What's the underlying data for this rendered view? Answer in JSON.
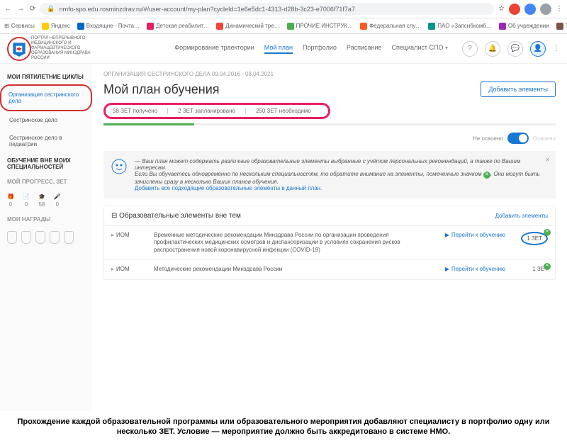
{
  "browser": {
    "url": "nmfo-spo.edu.rosminzdrav.ru/#/user-account/my-plan?cycleId=1e6e5dc1-4313-d28b-3c23-e7006f71f7a7",
    "bookmarks": [
      "Сервисы",
      "Яндекс",
      "Входящие - Почта…",
      "Детская реабилит…",
      "Динамический тре…",
      "ПРОЧИЕ ИНСТРУК…",
      "Федеральная слу…",
      "ПАО «Запсибкомб…",
      "Об учреждении",
      "Тюменская госуда…"
    ]
  },
  "header": {
    "logo_text": "ПОРТАЛ НЕПРЕРЫВНОГО МЕДИЦИНСКОГО И ФАРМАЦЕВТИЧЕСКОГО ОБРАЗОВАНИЯ МИНЗДРАВА РОССИИ",
    "tabs": [
      "Формирование траектории",
      "Мой план",
      "Портфолио",
      "Расписание",
      "Специалист СПО"
    ]
  },
  "sidebar": {
    "title1": "МОИ ПЯТИЛЕТНИЕ ЦИКЛЫ",
    "items1": [
      "Организация сестринского дела",
      "Сестринское дело",
      "Сестринское дело в педиатрии"
    ],
    "title2": "ОБУЧЕНИЕ ВНЕ МОИХ СПЕЦИАЛЬНОСТЕЙ",
    "title3": "МОЙ ПРОГРЕСС, ЗЕТ",
    "progress": [
      {
        "icon": "🎁",
        "val": "0"
      },
      {
        "icon": "📄",
        "val": "0"
      },
      {
        "icon": "🎓",
        "val": "58"
      },
      {
        "icon": "🎤",
        "val": "0"
      }
    ],
    "title4": "МОИ НАГРАДЫ"
  },
  "content": {
    "breadcrumb": "ОРГАНИЗАЦИЯ СЕСТРИНСКОГО ДЕЛА 09.04.2016 - 08.04.2021",
    "title": "Мой план обучения",
    "add_btn": "Добавить элементы",
    "stats": [
      "58 ЗЕТ получено",
      "2 ЗЕТ запланировано",
      "250 ЗЕТ необходимо"
    ],
    "toggle_left": "Не освоено",
    "toggle_right": "Освоено",
    "info": {
      "line1": "— Ваш план может содержать различные образовательные элементы выбранные с учётом персональных рекомендаций, а также по Вашим интересам.",
      "line2": "Если Вы обучаетесь одновременно по нескольким специальностям, то обратите внимание на элементы, помеченные значком",
      "line2b": ". Они могут быть зачислены сразу в несколько Ваших планов обучения.",
      "link": "Добавить все подходящие образовательные элементы в данный план."
    },
    "section_title": "Образовательные элементы вне тем",
    "section_add": "Добавить элементы",
    "courses": [
      {
        "type": "ИОМ",
        "desc": "Временные методические рекомендации Минздрава России по организации проведения профилактических медицинских осмотров и диспансеризации в условиях сохранения рисков распространения новой коронавирусной инфекции (COVID-19)",
        "link": "Перейти к обучению",
        "zet": "1 ЗЕТ"
      },
      {
        "type": "ИОМ",
        "desc": "Методические рекомендации Минздрава России",
        "link": "Перейти к обучению",
        "zet": "1 ЗЕТ"
      }
    ]
  },
  "caption": "Прохождение каждой образовательной программы или образовательного мероприятия добавляют специалисту в портфолио одну или несколько ЗЕТ. Условие — мероприятие должно быть аккредитовано в системе НМО."
}
